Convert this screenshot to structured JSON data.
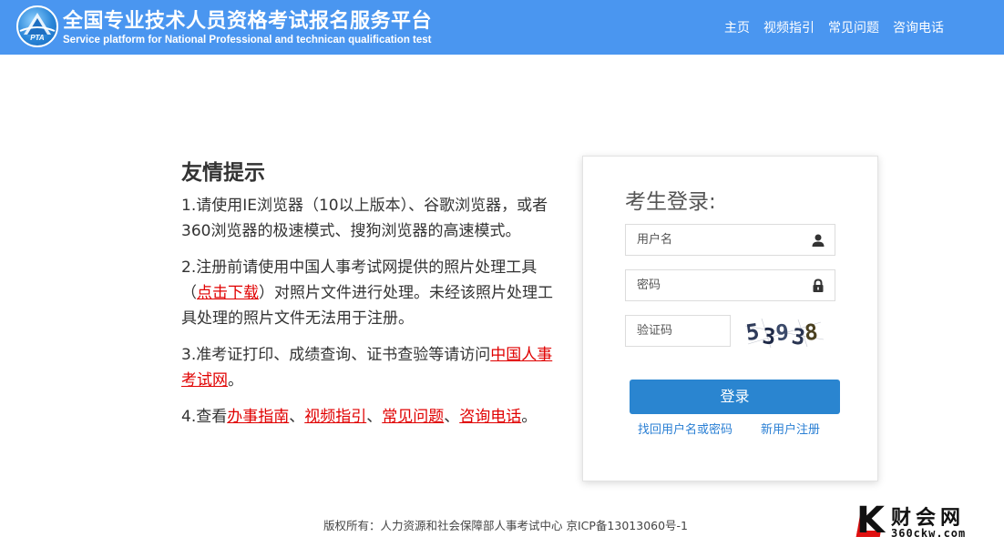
{
  "header": {
    "logo_text": "PTA",
    "title": "全国专业技术人员资格考试报名服务平台",
    "subtitle": "Service platform for National Professional and technican qualification test",
    "nav": [
      {
        "label": "主页"
      },
      {
        "label": "视频指引"
      },
      {
        "label": "常见问题"
      },
      {
        "label": "咨询电话"
      }
    ]
  },
  "tips": {
    "title": "友情提示",
    "tip1": "1.请使用IE浏览器（10以上版本）、谷歌浏览器，或者360浏览器的极速模式、搜狗浏览器的高速模式。",
    "tip2_before": "2.注册前请使用中国人事考试网提供的照片处理工具（",
    "tip2_link": "点击下载",
    "tip2_after": "）对照片文件进行处理。未经该照片处理工具处理的照片文件无法用于注册。",
    "tip3_before": "3.准考证打印、成绩查询、证书查验等请访问",
    "tip3_link": "中国人事考试网",
    "tip3_after": "。",
    "tip4_before": "4.查看",
    "tip4_links": [
      "办事指南",
      "视频指引",
      "常见问题",
      "咨询电话"
    ],
    "tip4_sep": "、",
    "tip4_after": "。"
  },
  "login": {
    "title": "考生登录:",
    "username_placeholder": "用户名",
    "password_placeholder": "密码",
    "captcha_placeholder": "验证码",
    "captcha_text": "53938",
    "submit_label": "登录",
    "forgot_label": "找回用户名或密码",
    "register_label": "新用户注册"
  },
  "footer": {
    "copyright": "版权所有：人力资源和社会保障部人事考试中心 京ICP备13013060号-1"
  },
  "watermark": {
    "letter": "K",
    "name": "财会网",
    "url": "360ckw.com"
  },
  "colors": {
    "header_bg": "#4a96f0",
    "link_red": "#e00000",
    "button_blue": "#2a85d0",
    "link_blue": "#2a7fd4"
  }
}
